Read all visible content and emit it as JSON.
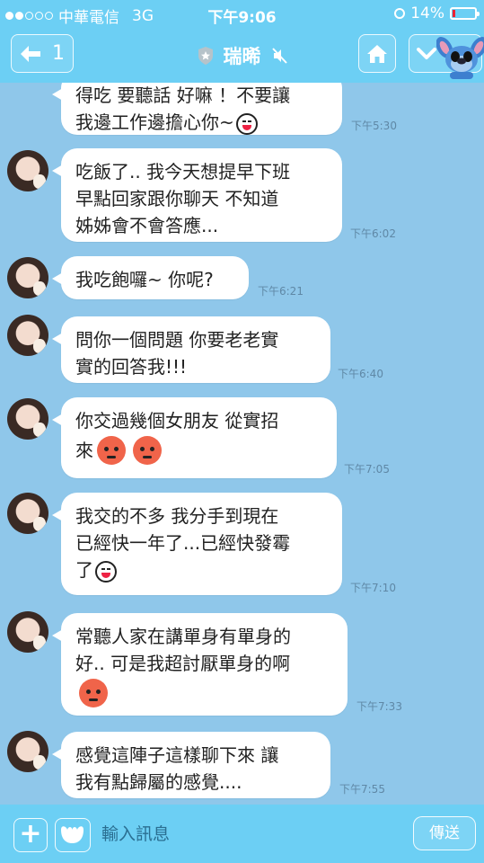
{
  "status_bar": {
    "carrier": "中華電信",
    "network": "3G",
    "time": "下午9:06",
    "battery": "14%",
    "battery_level": 0.14,
    "signal_dots": 2,
    "signal_total": 5
  },
  "nav": {
    "back_count": "1",
    "contact_name": "瑞晞",
    "icons": {
      "back": "arrow-left-icon",
      "shield": "shield-icon",
      "mute": "mute-icon",
      "home": "home-icon",
      "menu": "chevron-down-icon",
      "mascot": "stitch-avatar"
    }
  },
  "messages": [
    {
      "lines": [
        "得吃 要聽話 好嘛 ！不要讓",
        "我邊工作邊擔心你~"
      ],
      "emoji": [
        "laugh"
      ],
      "time": "下午5:30",
      "has_avatar": false
    },
    {
      "lines": [
        "吃飯了.. 我今天想提早下班",
        "早點回家跟你聊天 不知道",
        "姊姊會不會答應..."
      ],
      "emoji": [],
      "time": "下午6:02",
      "has_avatar": true
    },
    {
      "lines": [
        "我吃飽囉~ 你呢?"
      ],
      "emoji": [],
      "time": "下午6:21",
      "has_avatar": true
    },
    {
      "lines": [
        "問你一個問題 你要老老實",
        "實的回答我!!!"
      ],
      "emoji": [],
      "time": "下午6:40",
      "has_avatar": true
    },
    {
      "lines": [
        "你交過幾個女朋友  從實招",
        "來"
      ],
      "emoji": [
        "angry",
        "angry"
      ],
      "time": "下午7:05",
      "has_avatar": true
    },
    {
      "lines": [
        "我交的不多  我分手到現在",
        "已經快一年了...已經快發霉",
        "了"
      ],
      "emoji": [
        "laugh"
      ],
      "time": "下午7:10",
      "has_avatar": true
    },
    {
      "lines": [
        "常聽人家在講單身有單身的",
        "好..  可是我超討厭單身的啊"
      ],
      "emoji": [
        "angry-line"
      ],
      "time": "下午7:33",
      "has_avatar": true
    },
    {
      "lines": [
        "感覺這陣子這樣聊下來  讓",
        "我有點歸屬的感覺...."
      ],
      "emoji": [],
      "time": "下午7:55",
      "has_avatar": true
    }
  ],
  "input_bar": {
    "placeholder": "輸入訊息",
    "send_label": "傳送",
    "icons": {
      "plus": "plus-icon",
      "sticker": "sticker-icon"
    }
  },
  "colors": {
    "header": "#6ccff4",
    "chat_background": "#8fc7ea",
    "bubble": "#ffffff",
    "time": "#5f88a6",
    "battery_low": "#ee2233"
  }
}
